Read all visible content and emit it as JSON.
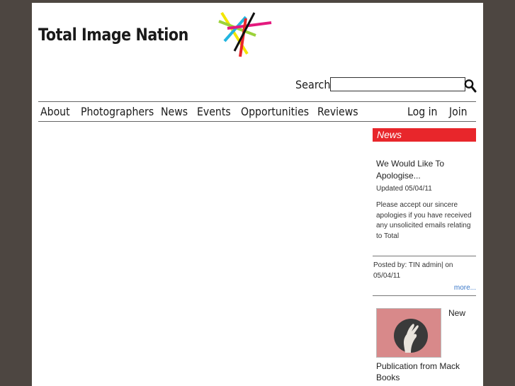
{
  "site": {
    "logo_text": "Total Image Nation"
  },
  "search": {
    "label": "Search",
    "value": "",
    "placeholder": ""
  },
  "nav": {
    "items": [
      "About",
      "Photographers",
      "News",
      "Events",
      "Opportunities",
      "Reviews"
    ],
    "account": [
      "Log in",
      "Join"
    ]
  },
  "sidebar": {
    "header": "News",
    "article": {
      "title": "We Would Like To Apologise...",
      "updated": "Updated 05/04/11",
      "excerpt": "Please accept our sincere apologies if you have received any unsolicited emails relating to Total",
      "posted": "Posted by: TIN admin| on 05/04/11",
      "more": "more..."
    },
    "item2": {
      "first_word": "New",
      "title": "Publication from Mack Books"
    }
  },
  "colors": {
    "frame": "#4d4641",
    "news_header": "#e8262b",
    "link": "#3a78c8"
  }
}
